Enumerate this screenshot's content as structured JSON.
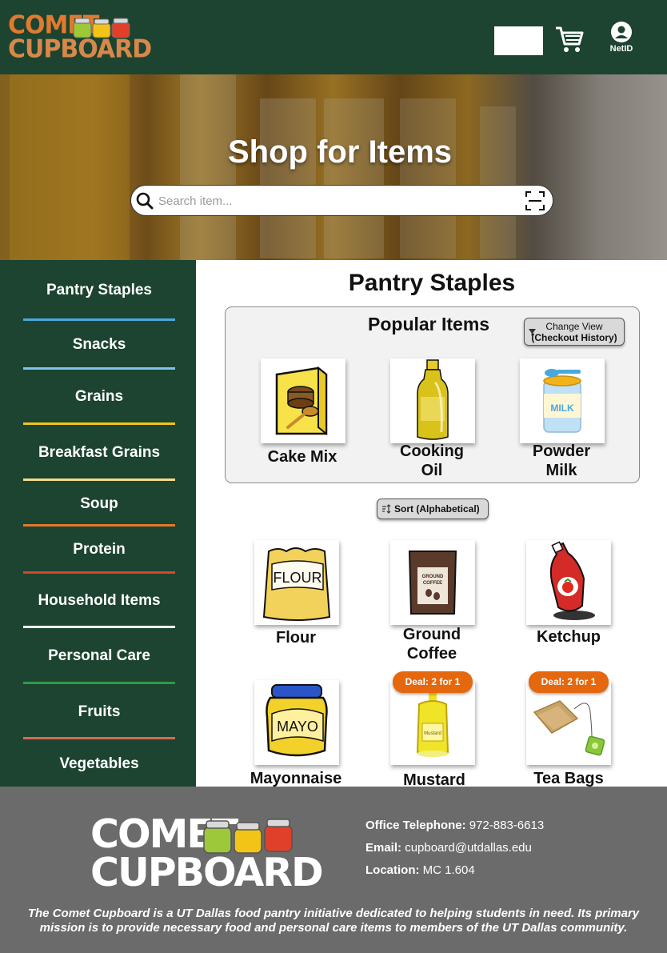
{
  "header": {
    "logo_line1": "COMET",
    "logo_line2": "CUPBOARD",
    "cart_icon": "shopping-cart-icon",
    "account_icon": "user-circle-icon",
    "account_label": "NetID"
  },
  "hero": {
    "title": "Shop for Items",
    "search_placeholder": "Search item...",
    "search_icon": "search-icon",
    "scan_icon": "barcode-scan-icon"
  },
  "sidebar": {
    "items": [
      {
        "label": "Pantry Staples",
        "color": "#4aa8e0"
      },
      {
        "label": "Snacks",
        "color": "#7cc4ec"
      },
      {
        "label": "Grains",
        "color": "#f2c418"
      },
      {
        "label": "Breakfast Grains",
        "color": "#f2dc84"
      },
      {
        "label": "Soup",
        "color": "#e07a2e"
      },
      {
        "label": "Protein",
        "color": "#d9472b"
      },
      {
        "label": "Household Items",
        "color": "#ffffff"
      },
      {
        "label": "Personal Care",
        "color": "#2e9a4a"
      },
      {
        "label": "Fruits",
        "color": "#d46a55"
      },
      {
        "label": "Vegetables",
        "color": ""
      }
    ]
  },
  "main": {
    "title": "Pantry Staples",
    "popular_title": "Popular Items",
    "change_view_line1": "Change View",
    "change_view_line2": "(Checkout History)",
    "popular_items": [
      {
        "line1": "Cake Mix",
        "line2": ""
      },
      {
        "line1": "Cooking",
        "line2": "Oil"
      },
      {
        "line1": "Powder",
        "line2": "Milk"
      }
    ],
    "sort_label": "Sort (Alphabetical)",
    "items": [
      {
        "line1": "Flour",
        "line2": "",
        "deal": ""
      },
      {
        "line1": "Ground",
        "line2": "Coffee",
        "deal": ""
      },
      {
        "line1": "Ketchup",
        "line2": "",
        "deal": ""
      },
      {
        "line1": "Mayonnaise",
        "line2": "",
        "deal": ""
      },
      {
        "line1": "Mustard",
        "line2": "",
        "deal": "Deal: 2 for 1"
      },
      {
        "line1": "Tea Bags",
        "line2": "",
        "deal": "Deal: 2 for 1"
      }
    ],
    "colors": {
      "sidebar_bg": "#1c4430",
      "deal_badge": "#e5670e",
      "footer_bg": "#6b6b6b"
    }
  },
  "footer": {
    "logo_line1": "COMET",
    "logo_line2": "CUPBOARD",
    "phone_label": "Office Telephone:",
    "phone_value": "972-883-6613",
    "email_label": "Email:",
    "email_value": "cupboard@utdallas.edu",
    "location_label": "Location:",
    "location_value": "MC 1.604",
    "mission": "The Comet Cupboard is a UT Dallas food pantry initiative dedicated to helping students in need. Its primary mission is to provide necessary food and personal care items to members of the UT Dallas community."
  }
}
